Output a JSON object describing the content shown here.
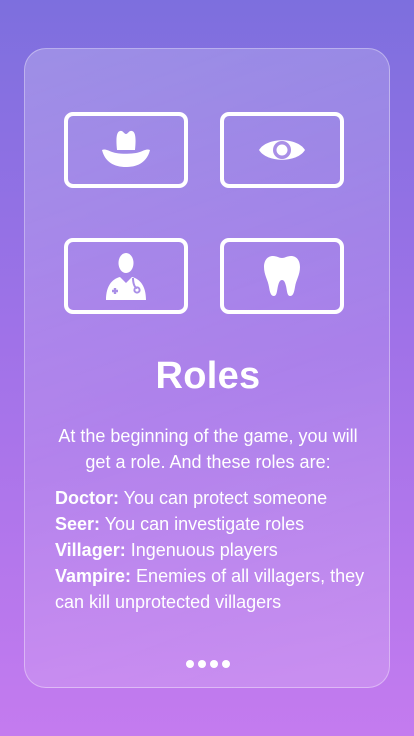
{
  "card": {
    "title": "Roles",
    "intro": "At the beginning of the game, you will get a role. And these roles are:",
    "role_icons": [
      "cowboy-hat-icon",
      "eye-icon",
      "doctor-icon",
      "tooth-icon"
    ],
    "roles": [
      {
        "name": "Doctor:",
        "description": " You can protect someone"
      },
      {
        "name": "Seer:",
        "description": " You can investigate roles"
      },
      {
        "name": "Villager:",
        "description": " Ingenuous players"
      },
      {
        "name": "Vampire:",
        "description": " Enemies of all villagers, they can kill unprotected villagers"
      }
    ],
    "page_dots": 4
  },
  "colors": {
    "background_top": "#7d6fde",
    "background_bottom": "#c47bef",
    "foreground": "#ffffff"
  }
}
